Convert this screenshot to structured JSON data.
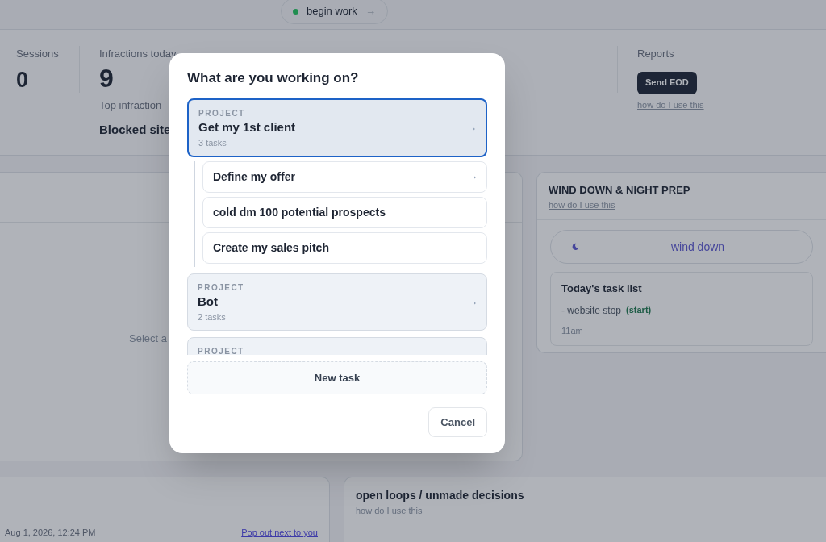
{
  "top_bar": {
    "begin_button": {
      "label": "begin work",
      "arrow": "→"
    }
  },
  "stats": {
    "sessions": {
      "label": "Sessions",
      "value": "0"
    },
    "infractions": {
      "label": "Infractions today",
      "value": "9",
      "top_label": "Top infraction",
      "top_value": "Blocked site"
    },
    "reports": {
      "label": "Reports",
      "button": "Send EOD",
      "help_link": "how do I use this"
    }
  },
  "focus_panel": {
    "empty_text": "Select a"
  },
  "wind_down_panel": {
    "title": "WIND DOWN & NIGHT PREP",
    "help_link": "how do I use this",
    "wind_down_button": "wind down",
    "task_list": {
      "title": "Today's task list",
      "items": [
        {
          "text": "- website stop",
          "action": "(start)"
        }
      ],
      "time": "11am"
    }
  },
  "log_panel": {
    "timestamp": "Aug 1, 2026, 12:24 PM",
    "pop_out_link": "Pop out next to you"
  },
  "open_loops_panel": {
    "title": "open loops / unmade decisions",
    "help_link": "how do I use this"
  },
  "modal": {
    "title": "What are you working on?",
    "projects": [
      {
        "label": "PROJECT",
        "name": "Get my 1st client",
        "count": "3 tasks",
        "selected": true,
        "tasks": [
          {
            "name": "Define my offer",
            "has_caret": true
          },
          {
            "name": "cold dm 100 potential prospects",
            "has_caret": false
          },
          {
            "name": "Create my sales pitch",
            "has_caret": false
          }
        ]
      },
      {
        "label": "PROJECT",
        "name": "Bot",
        "count": "2 tasks",
        "selected": false
      },
      {
        "label": "PROJECT",
        "selected": false
      }
    ],
    "new_task_button": "New task",
    "cancel_button": "Cancel"
  }
}
